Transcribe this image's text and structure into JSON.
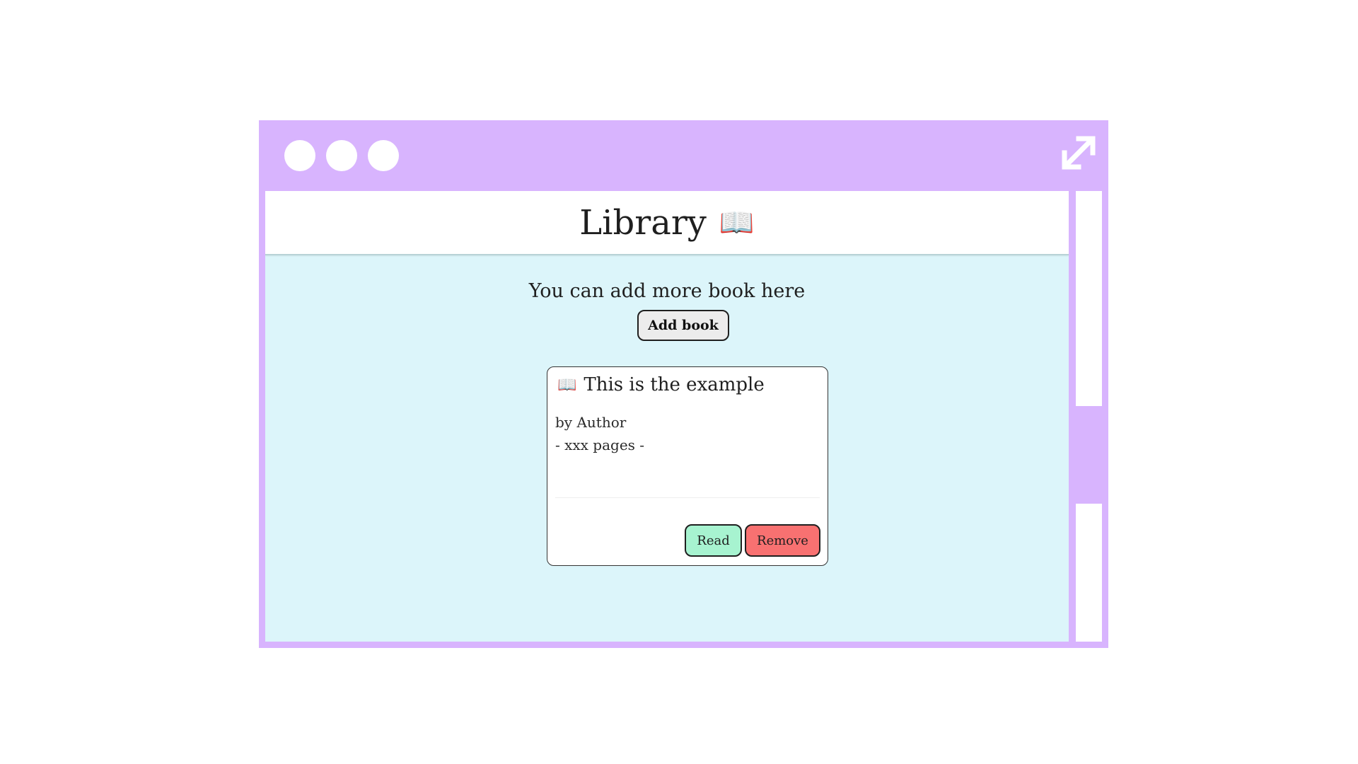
{
  "window": {
    "controls": [
      "window-dot",
      "window-dot",
      "window-dot"
    ],
    "expand_icon": "expand-arrows-icon",
    "frame_color": "#d8b4fe"
  },
  "header": {
    "title": "Library",
    "icon": "📖"
  },
  "main": {
    "prompt": "You can add more book here",
    "add_button_label": "Add book",
    "background": "#dcf5fa"
  },
  "books": [
    {
      "icon": "📖",
      "title": "This is the example",
      "author": "by Author",
      "pages": "- xxx pages -",
      "read_label": "Read",
      "remove_label": "Remove",
      "read_color": "#a7f3d0",
      "remove_color": "#f87171"
    }
  ]
}
